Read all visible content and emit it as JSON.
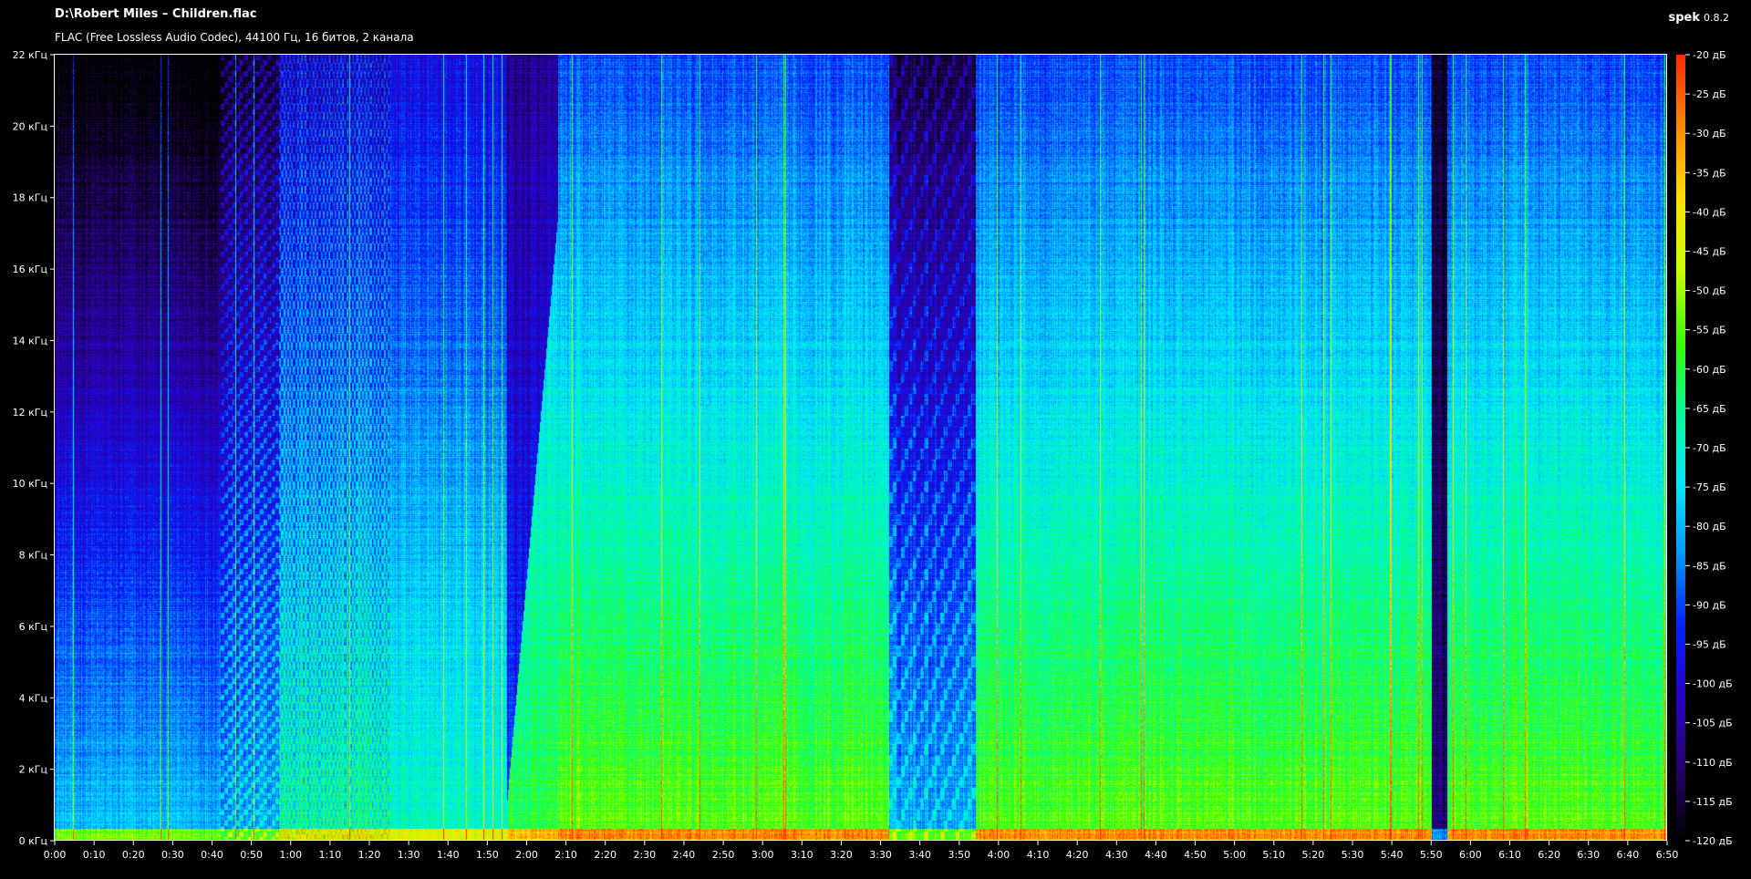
{
  "app": {
    "name": "spek",
    "version": "0.8.2"
  },
  "file": {
    "path": "D:\\Robert Miles – Children.flac",
    "info": "FLAC (Free Lossless Audio Codec), 44100 Гц, 16 битов, 2 канала"
  },
  "chart_data": {
    "type": "heatmap",
    "title": "D:\\Robert Miles – Children.flac",
    "subtitle": "FLAC (Free Lossless Audio Codec), 44100 Гц, 16 битов, 2 канала",
    "x_axis": {
      "unit": "time",
      "range_seconds": [
        0,
        410
      ],
      "ticks": [
        "0:00",
        "0:10",
        "0:20",
        "0:30",
        "0:40",
        "0:50",
        "1:00",
        "1:10",
        "1:20",
        "1:30",
        "1:40",
        "1:50",
        "2:00",
        "2:10",
        "2:20",
        "2:30",
        "2:40",
        "2:50",
        "3:00",
        "3:10",
        "3:20",
        "3:30",
        "3:40",
        "3:50",
        "4:00",
        "4:10",
        "4:20",
        "4:30",
        "4:40",
        "4:50",
        "5:00",
        "5:10",
        "5:20",
        "5:30",
        "5:40",
        "5:50",
        "6:00",
        "6:10",
        "6:20",
        "6:30",
        "6:40",
        "6:50"
      ]
    },
    "y_axis": {
      "unit": "кГц",
      "range_khz": [
        0,
        22
      ],
      "ticks": [
        "0 кГц",
        "2 кГц",
        "4 кГц",
        "6 кГц",
        "8 кГц",
        "10 кГц",
        "12 кГц",
        "14 кГц",
        "16 кГц",
        "18 кГц",
        "20 кГц",
        "22 кГц"
      ],
      "tick_values": [
        0,
        2,
        4,
        6,
        8,
        10,
        12,
        14,
        16,
        18,
        20,
        22
      ]
    },
    "color_scale": {
      "unit": "дБ",
      "range_db": [
        -120,
        -20
      ],
      "ticks": [
        "-20 дБ",
        "-25 дБ",
        "-30 дБ",
        "-35 дБ",
        "-40 дБ",
        "-45 дБ",
        "-50 дБ",
        "-55 дБ",
        "-60 дБ",
        "-65 дБ",
        "-70 дБ",
        "-75 дБ",
        "-80 дБ",
        "-85 дБ",
        "-90 дБ",
        "-95 дБ",
        "-100 дБ",
        "-105 дБ",
        "-110 дБ",
        "-115 дБ",
        "-120 дБ"
      ],
      "tick_values": [
        -20,
        -25,
        -30,
        -35,
        -40,
        -45,
        -50,
        -55,
        -60,
        -65,
        -70,
        -75,
        -80,
        -85,
        -90,
        -95,
        -100,
        -105,
        -110,
        -115,
        -120
      ],
      "colors": [
        "#000000",
        "#26006e",
        "#2a00c8",
        "#0022ff",
        "#0099ff",
        "#00eaff",
        "#00ff9a",
        "#3cff00",
        "#c8ff00",
        "#ffe000",
        "#ff8a00",
        "#ff2a00"
      ]
    },
    "segments_seconds": [
      {
        "start": 0,
        "end": 42,
        "level": "quiet"
      },
      {
        "start": 42,
        "end": 57,
        "level": "sparse"
      },
      {
        "start": 57,
        "end": 85,
        "level": "pulsed"
      },
      {
        "start": 85,
        "end": 115,
        "level": "build"
      },
      {
        "start": 115,
        "end": 128,
        "level": "riser"
      },
      {
        "start": 128,
        "end": 212,
        "level": "full"
      },
      {
        "start": 212,
        "end": 234,
        "level": "breakdown"
      },
      {
        "start": 234,
        "end": 263,
        "level": "full"
      },
      {
        "start": 263,
        "end": 350,
        "level": "full"
      },
      {
        "start": 350,
        "end": 354,
        "level": "gap"
      },
      {
        "start": 354,
        "end": 410,
        "level": "full"
      }
    ]
  }
}
